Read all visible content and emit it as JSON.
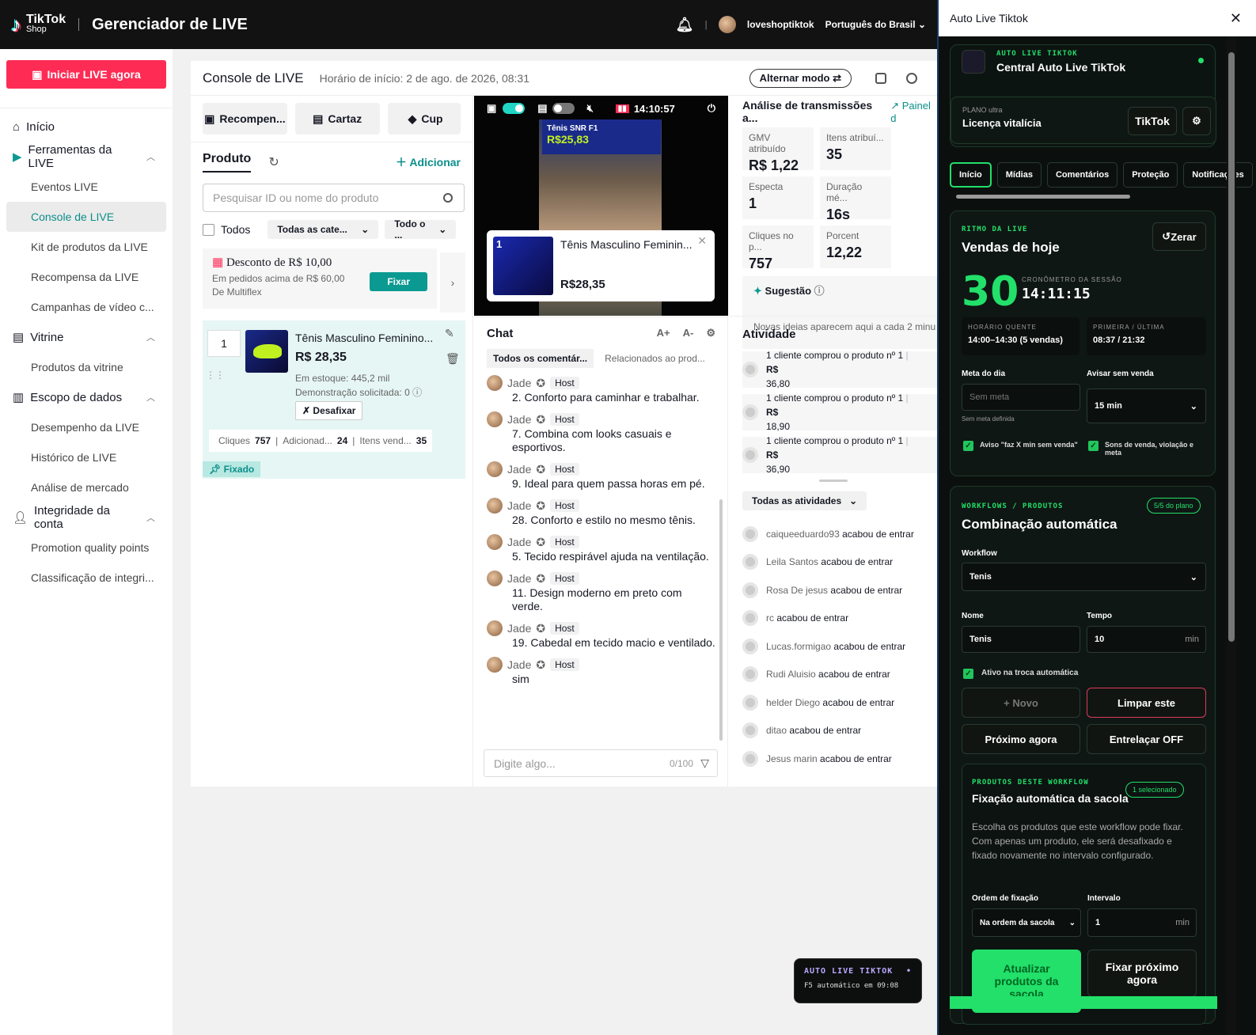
{
  "topbar": {
    "logo_main": "TikTok",
    "logo_sub": "Shop",
    "title": "Gerenciador de LIVE",
    "user": "loveshoptiktok",
    "language": "Português do Brasil"
  },
  "sidebar": {
    "go_live": "Iniciar LIVE agora",
    "items": [
      "Início",
      "Ferramentas da LIVE",
      "Eventos LIVE",
      "Console de LIVE",
      "Kit de produtos da LIVE",
      "Recompensa da LIVE",
      "Campanhas de vídeo c...",
      "Vitrine",
      "Produtos da vitrine",
      "Escopo de dados",
      "Desempenho da LIVE",
      "Histórico de LIVE",
      "Análise de mercado",
      "Integridade da conta",
      "Promotion quality points",
      "Classificação de integri..."
    ]
  },
  "console": {
    "title": "Console de LIVE",
    "start": "Horário de início: 2 de ago. de 2026, 08:31",
    "switch_mode": "Alternar modo",
    "buttons": [
      "Recompen...",
      "Cartaz",
      "Cup"
    ],
    "product_tab": "Produto",
    "add": "Adicionar",
    "search_placeholder": "Pesquisar ID ou nome do produto",
    "all": "Todos",
    "cat": "Todas as cate...",
    "all2": "Todo o ...",
    "promo": {
      "title": "Desconto de R$ 10,00",
      "line1": "Em pedidos acima de R$ 60,00",
      "line2": "De Multiflex",
      "fix": "Fixar"
    },
    "product": {
      "qty": "1",
      "name": "Tênis Masculino Feminino...",
      "price": "R$ 28,35",
      "stock": "Em estoque: 445,2 mil",
      "demo": "Demonstração solicitada: 0",
      "unfix": "Desafixar",
      "clicks_l": "Cliques",
      "clicks": "757",
      "added_l": "Adicionad...",
      "added": "24",
      "sold_l": "Itens vend...",
      "sold": "35",
      "pinned": "Fixado"
    }
  },
  "video": {
    "time": "14:10:57",
    "banner": "Tênis SNR F1",
    "banner_price": "R$25,83",
    "card_idx": "1",
    "card_name": "Tênis Masculino Feminin...",
    "card_price": "R$28,35"
  },
  "chat": {
    "title": "Chat",
    "font_up": "A+",
    "font_down": "A-",
    "tab_all": "Todos os comentár...",
    "tab_rel": "Relacionados ao prod...",
    "author": "Jade",
    "host": "Host",
    "messages": [
      "2. Conforto para caminhar e trabalhar.",
      "7. Combina com looks casuais e esportivos.",
      "9. Ideal para quem passa horas em pé.",
      "28. Conforto e estilo no mesmo tênis.",
      "5. Tecido respirável ajuda na ventilação.",
      "11. Design moderno em preto com verde.",
      "19. Cabedal em tecido macio e ventilado.",
      "sim"
    ],
    "input_placeholder": "Digite algo...",
    "counter": "0/100"
  },
  "analysis": {
    "title": "Análise de transmissões a...",
    "link": "Painel d",
    "kpis": [
      {
        "l": "GMV atribuído",
        "v": "R$ 1,22 ..."
      },
      {
        "l": "Itens atribuí...",
        "v": "35"
      },
      {
        "l": "Especta",
        "v": "1"
      },
      {
        "l": "Duração mé...",
        "v": "16s"
      },
      {
        "l": "Cliques no p...",
        "v": "757"
      },
      {
        "l": "Porcent",
        "v": "12,22"
      }
    ],
    "suggestion": "Sugestão",
    "suggestion_text": "Novas ideias aparecem aqui a cada 2 minu"
  },
  "activity": {
    "title": "Atividade",
    "purchases": [
      {
        "t": "1 cliente comprou o produto nº 1",
        "v1": "R$",
        "v2": "36,80"
      },
      {
        "t": "1 cliente comprou o produto nº 1",
        "v1": "R$",
        "v2": "18,90"
      },
      {
        "t": "1 cliente comprou o produto nº 1",
        "v1": "R$",
        "v2": "36,90"
      }
    ],
    "filter": "Todas as atividades",
    "suffix": "acabou de entrar",
    "entries": [
      "caiqueeduardo93",
      "Leila Santos",
      "Rosa De jesus",
      "rc",
      "Lucas.formigao",
      "Rudi Aluisio",
      "helder Diego",
      "ditao",
      "Jesus marin"
    ]
  },
  "float": {
    "title": "AUTO LIVE TIKTOK",
    "dot": "•",
    "status": "F5 automático em 09:08"
  },
  "panel": {
    "window_title": "Auto Live Tiktok",
    "brand_tag": "AUTO LIVE TIKTOK",
    "brand_name": "Central Auto Live TikTok",
    "plan_label": "PLANO ultra",
    "plan": "Licença vitalícia",
    "platform": "TikTok",
    "tabs": [
      "Início",
      "Mídias",
      "Comentários",
      "Proteção",
      "Notificações"
    ],
    "rhythm": {
      "tag": "RITMO DA LIVE",
      "title": "Vendas de hoje",
      "reset": "Zerar",
      "count": "30",
      "timer_label": "CRONÔMETRO DA SESSÃO",
      "timer": "14:11:15",
      "hot_label": "HORÁRIO QUENTE",
      "hot": "14:00–14:30 (5 vendas)",
      "fl_label": "PRIMEIRA / ÚLTIMA",
      "fl": "08:37 / 21:32",
      "goal_label": "Meta do dia",
      "goal_placeholder": "Sem meta",
      "goal_note": "Sem meta definida",
      "warn_label": "Avisar sem venda",
      "warn": "15 min",
      "chk1": "Aviso \"faz X min sem venda\"",
      "chk2": "Sons de venda, violação e meta"
    },
    "workflow": {
      "tag": "WORKFLOWS / PRODUTOS",
      "badge": "5/5 do plano",
      "title": "Combinação automática",
      "wf_label": "Workflow",
      "wf": "Tenis",
      "name_label": "Nome",
      "name": "Tenis",
      "time_label": "Tempo",
      "time": "10",
      "unit": "min",
      "active": "Ativo na troca automática",
      "new": "+ Novo",
      "clear": "Limpar este",
      "next": "Próximo agora",
      "interleave": "Entrelaçar OFF"
    },
    "products": {
      "tag": "PRODUTOS DESTE WORKFLOW",
      "badge": "1 selecionado",
      "title": "Fixação automática da sacola",
      "desc": "Escolha os produtos que este workflow pode fixar. Com apenas um produto, ele será desafixado e fixado novamente no intervalo configurado.",
      "order_label": "Ordem de fixação",
      "order": "Na ordem da sacola",
      "interval_label": "Intervalo",
      "interval": "1",
      "unit": "min",
      "update": "Atualizar produtos da sacola",
      "fix_next": "Fixar próximo agora"
    }
  }
}
